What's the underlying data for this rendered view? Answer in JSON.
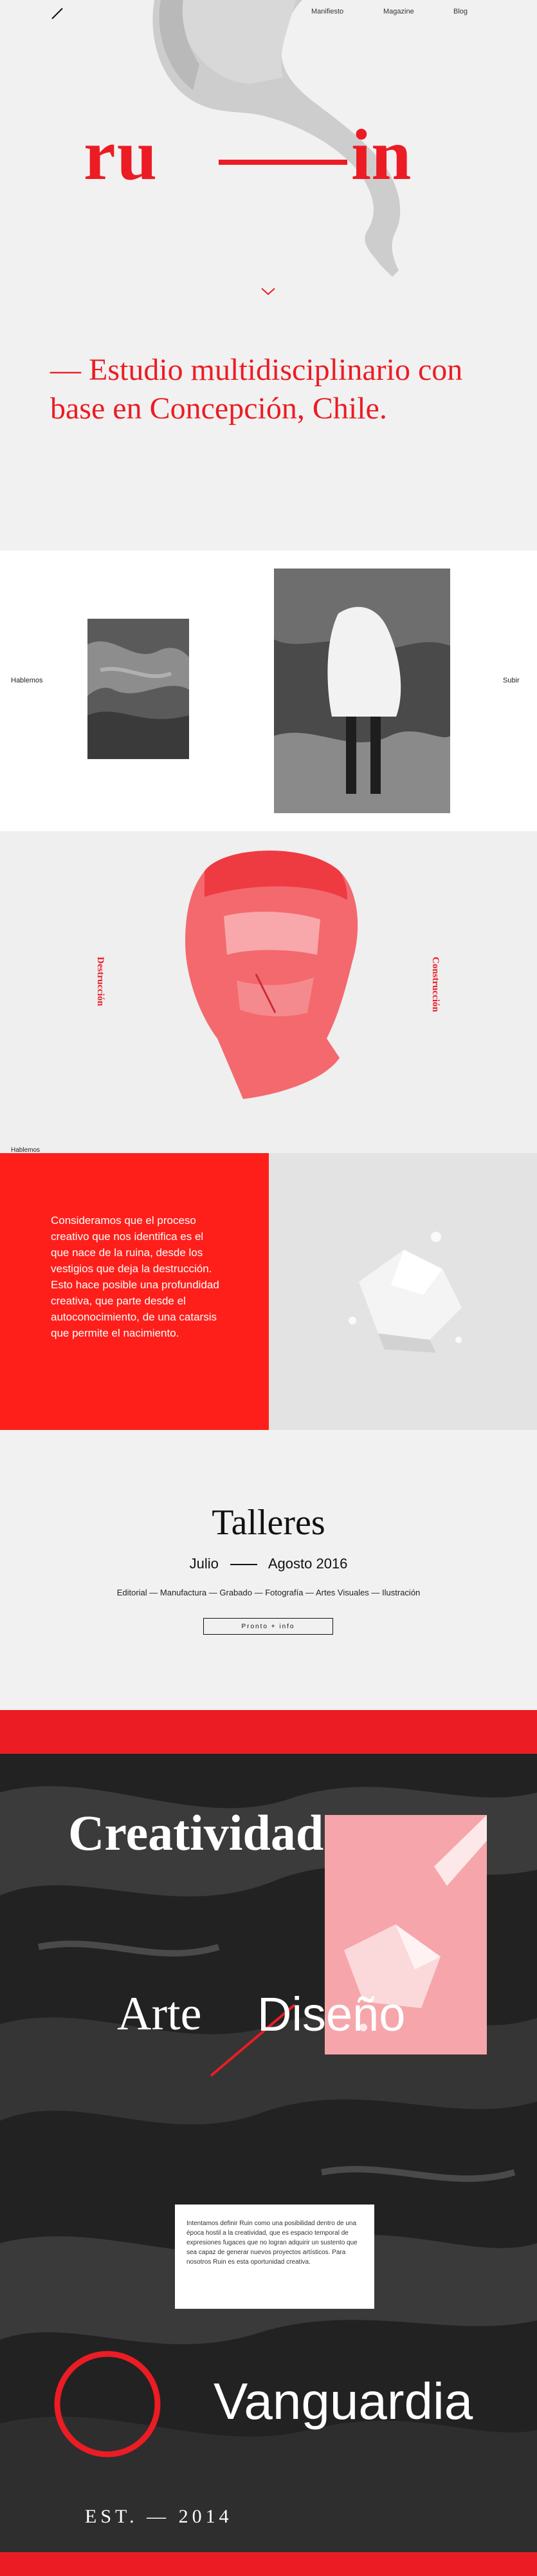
{
  "nav": {
    "items": [
      "Manifiesto",
      "Magazine",
      "Blog"
    ]
  },
  "hero": {
    "logo_left": "ru",
    "logo_right": "in",
    "tagline": "— Estudio multidisciplinario con base en Concepción, Chile."
  },
  "gallery": {
    "left_label": "Hablemos",
    "right_label": "Subir"
  },
  "bust": {
    "left_label": "Destrucción",
    "right_label": "Construcción",
    "bottom_label": "Hablemos"
  },
  "about": {
    "text": "Consideramos que el proceso creativo que nos identifica es el que nace de la ruina, desde los vestigios que deja la destrucción. Esto hace posible una profundidad creativa, que parte desde el autoconocimiento, de una catarsis que permite el nacimiento."
  },
  "talleres": {
    "title": "Talleres",
    "date_start": "Julio",
    "date_end": "Agosto 2016",
    "topics": "Editorial — Manufactura — Grabado — Fotografía — Artes Visuales — Ilustración",
    "button_label": "Pronto + info"
  },
  "dark": {
    "creatividad": "Creatividad",
    "arte": "Arte",
    "diseno": "Diseño",
    "card_text": "Intentamos definir Ruin como una posibilidad dentro de una época hostil a la creatividad, que es espacio temporal de expresiones fugaces que no logran adquirir un sustento que sea capaz de generar nuevos proyectos artísticos. Para nosotros Ruin es esta oportunidad creativa.",
    "vanguardia": "Vanguardia",
    "est": "EST. — 2014"
  },
  "colors": {
    "accent": "#ec1c24",
    "pink": "#f6a6aa"
  }
}
